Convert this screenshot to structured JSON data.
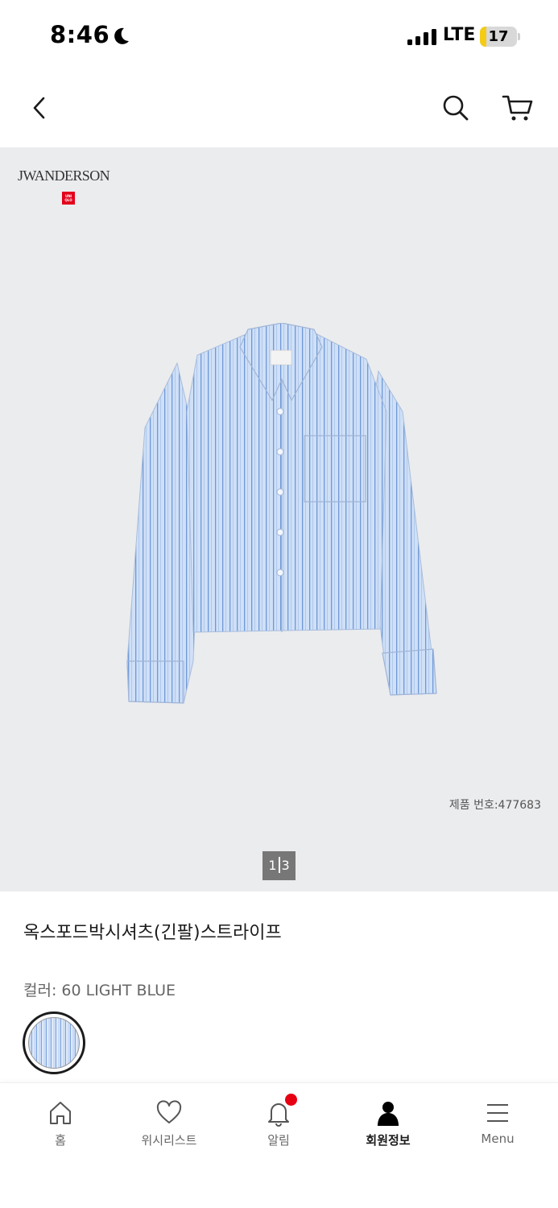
{
  "status_bar": {
    "time": "8:46",
    "network": "LTE",
    "battery": "17",
    "battery_level": 0.17,
    "moon_icon": "moon-icon",
    "signal_icon": "signal-icon"
  },
  "header": {
    "back_icon": "chevron-left-icon",
    "search_icon": "search-icon",
    "cart_icon": "cart-icon"
  },
  "gallery": {
    "brand": "JWANDERSON",
    "sub_brand": "UNI QLO",
    "product_code": "제품 번호:477683",
    "page_current": "1",
    "page_total": "3"
  },
  "product": {
    "name": "옥스포드박시셔츠(긴팔)스트라이프",
    "color_label": "컬러: 60 LIGHT BLUE"
  },
  "nav": {
    "items": [
      {
        "label": "홈",
        "icon": "home-icon"
      },
      {
        "label": "위시리스트",
        "icon": "heart-icon"
      },
      {
        "label": "알림",
        "icon": "bell-icon"
      },
      {
        "label": "회원정보",
        "icon": "person-icon"
      },
      {
        "label": "Menu",
        "icon": "menu-icon"
      }
    ]
  },
  "colors": {
    "accent": "#e60012",
    "gallery_bg": "#ebecee",
    "battery": "#f5cc15"
  }
}
